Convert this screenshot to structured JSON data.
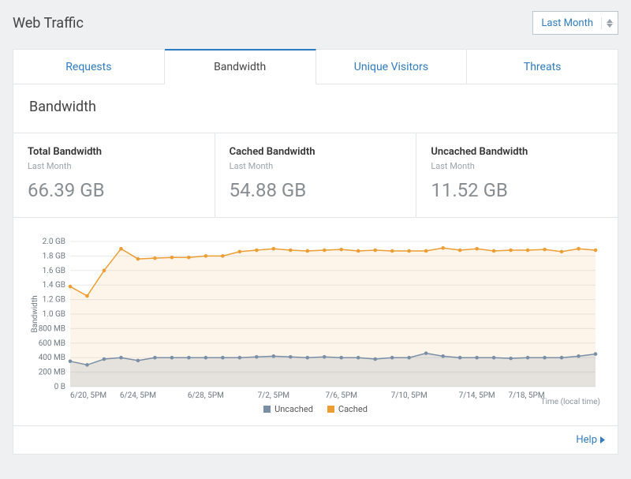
{
  "page_title": "Web Traffic",
  "time_range": {
    "label": "Last Month"
  },
  "tabs": [
    {
      "label": "Requests"
    },
    {
      "label": "Bandwidth"
    },
    {
      "label": "Unique Visitors"
    },
    {
      "label": "Threats"
    }
  ],
  "section_title": "Bandwidth",
  "stats": [
    {
      "label": "Total Bandwidth",
      "sub": "Last Month",
      "value": "66.39 GB"
    },
    {
      "label": "Cached Bandwidth",
      "sub": "Last Month",
      "value": "54.88 GB"
    },
    {
      "label": "Uncached Bandwidth",
      "sub": "Last Month",
      "value": "11.52 GB"
    }
  ],
  "legend": {
    "uncached": "Uncached",
    "cached": "Cached",
    "time_note": "Time (local time)"
  },
  "help": "Help",
  "colors": {
    "accent_blue": "#2f7bbf",
    "cached": "#ec9d33",
    "uncached": "#7a8fa6"
  },
  "chart_data": {
    "type": "area",
    "ylabel": "Bandwidth",
    "ylim": [
      0,
      2000
    ],
    "y_ticks": [
      "0 B",
      "200 MB",
      "400 MB",
      "600 MB",
      "800 MB",
      "1.0 GB",
      "1.2 GB",
      "1.4 GB",
      "1.6 GB",
      "1.8 GB",
      "2.0 GB"
    ],
    "x_tick_labels": [
      "6/20, 5PM",
      "6/24, 5PM",
      "6/28, 5PM",
      "7/2, 5PM",
      "7/6, 5PM",
      "7/10, 5PM",
      "7/14, 5PM",
      "7/18, 5PM"
    ],
    "x_tick_indices": [
      0,
      4,
      8,
      12,
      16,
      20,
      24,
      28
    ],
    "series": [
      {
        "name": "Cached",
        "color": "#ec9d33",
        "values": [
          1380,
          1250,
          1600,
          1900,
          1760,
          1770,
          1780,
          1780,
          1800,
          1800,
          1860,
          1880,
          1900,
          1880,
          1870,
          1880,
          1890,
          1870,
          1880,
          1870,
          1870,
          1870,
          1910,
          1880,
          1900,
          1870,
          1880,
          1880,
          1890,
          1860,
          1900,
          1880
        ]
      },
      {
        "name": "Uncached",
        "color": "#7a8fa6",
        "values": [
          350,
          300,
          380,
          400,
          360,
          400,
          400,
          400,
          400,
          400,
          400,
          410,
          420,
          410,
          400,
          410,
          400,
          400,
          380,
          400,
          400,
          460,
          420,
          400,
          400,
          400,
          390,
          400,
          400,
          400,
          420,
          450
        ]
      }
    ]
  }
}
